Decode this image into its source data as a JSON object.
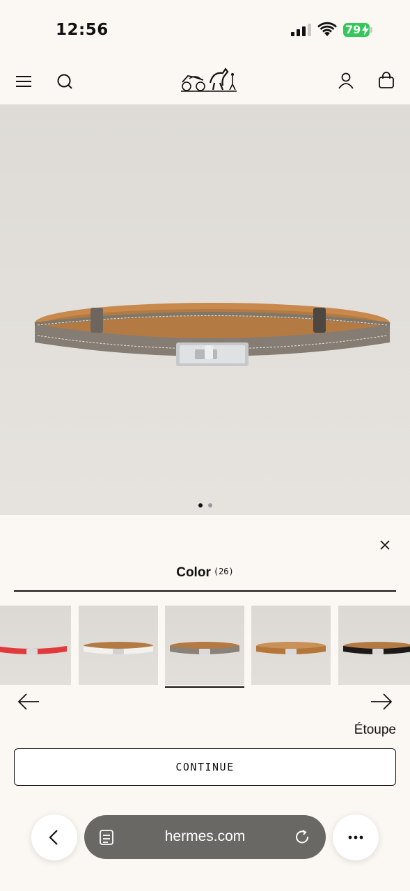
{
  "status": {
    "time": "12:56",
    "battery": "79"
  },
  "header": {
    "logo": "Hermès carriage logo"
  },
  "gallery": {
    "page_count": 2,
    "active_index": 0
  },
  "colors": {
    "accent": "#111111",
    "background": "#fbf8f3",
    "battery": "#34c759",
    "url_pill": "#6a6865"
  },
  "panel": {
    "tab_label": "Color",
    "tab_count": "(26)",
    "swatches": [
      {
        "color": "#e03a3c"
      },
      {
        "color": "#f2f1ee"
      },
      {
        "color": "#8a8178"
      },
      {
        "color": "#b5763a"
      },
      {
        "color": "#1c1a19"
      }
    ],
    "selected_swatch_index": 2,
    "selected_color": "Étoupe",
    "continue_label": "CONTINUE"
  },
  "browser": {
    "url": "hermes.com"
  }
}
